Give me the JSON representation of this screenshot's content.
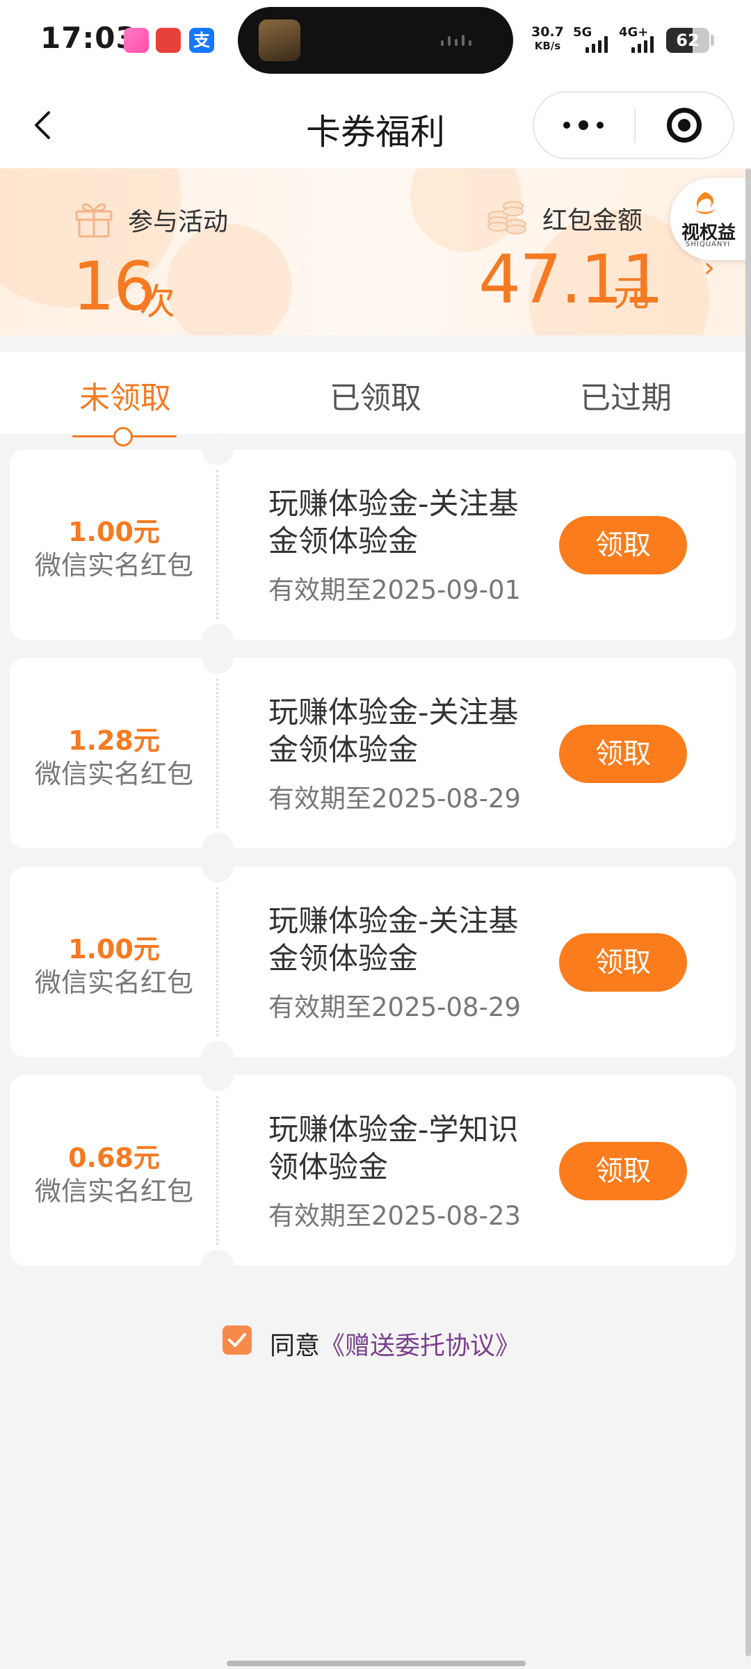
{
  "status_bar": {
    "time": "17:03",
    "net_speed": "30.7",
    "net_speed_unit": "KB/s",
    "net1": "5G",
    "net2": "4G+",
    "battery": "62",
    "battery_level": 0.62,
    "app_icons": [
      "camera-app-icon",
      "red-app-icon",
      "alipay-icon"
    ]
  },
  "nav": {
    "title": "卡券福利"
  },
  "stats": {
    "participations_label": "参与活动",
    "participations_value": "16",
    "participations_unit": "次",
    "redpacket_label": "红包金额",
    "redpacket_value": "47.11",
    "redpacket_unit": "元"
  },
  "badge": {
    "name": "视权益",
    "sub": "SHIQUANYI"
  },
  "tabs": [
    {
      "label": "未领取",
      "active": true
    },
    {
      "label": "已领取",
      "active": false
    },
    {
      "label": "已过期",
      "active": false
    }
  ],
  "coupons": [
    {
      "amount": "1.00元",
      "kind": "微信实名红包",
      "title": "玩赚体验金-关注基金领体验金",
      "expiry": "有效期至2025-09-01",
      "button": "领取"
    },
    {
      "amount": "1.28元",
      "kind": "微信实名红包",
      "title": "玩赚体验金-关注基金领体验金",
      "expiry": "有效期至2025-08-29",
      "button": "领取"
    },
    {
      "amount": "1.00元",
      "kind": "微信实名红包",
      "title": "玩赚体验金-关注基金领体验金",
      "expiry": "有效期至2025-08-29",
      "button": "领取"
    },
    {
      "amount": "0.68元",
      "kind": "微信实名红包",
      "title": "玩赚体验金-学知识领体验金",
      "expiry": "有效期至2025-08-23",
      "button": "领取"
    }
  ],
  "agreement": {
    "checked": true,
    "prefix": "同意",
    "link": "《赠送委托协议》"
  },
  "colors": {
    "accent": "#f57a21",
    "button": "#fb7c1c",
    "link": "#7a3f8f",
    "background": "#f4f4f4"
  }
}
